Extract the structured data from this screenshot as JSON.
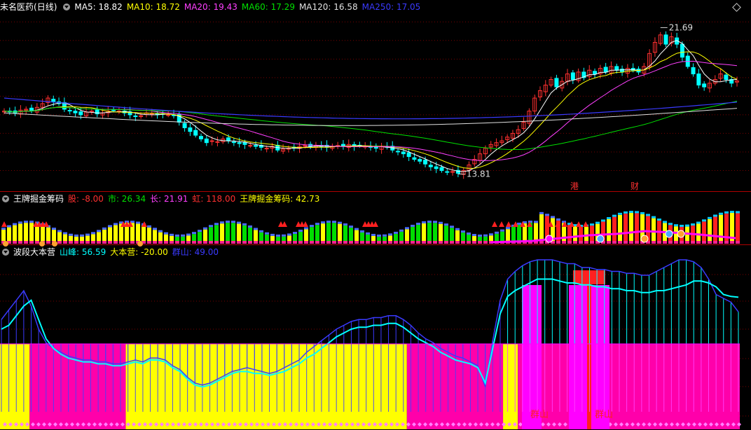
{
  "stock": {
    "name": "未名医药",
    "period": "(日线)"
  },
  "ma_header": [
    {
      "label": "MA5: 18.82",
      "color": "#ffffff"
    },
    {
      "label": "MA10: 18.72",
      "color": "#ffff00"
    },
    {
      "label": "MA20: 19.43",
      "color": "#ff40ff"
    },
    {
      "label": "MA60: 17.29",
      "color": "#00e000"
    },
    {
      "label": "MA120: 16.58",
      "color": "#e0e0e0"
    },
    {
      "label": "MA250: 17.05",
      "color": "#3a3aff"
    }
  ],
  "ind1": {
    "name": "王牌掘金筹码",
    "values": [
      {
        "label": "股: -8.00",
        "color": "#ff3030"
      },
      {
        "label": "市: 26.34",
        "color": "#00e000"
      },
      {
        "label": "长: 21.91",
        "color": "#ff40ff"
      },
      {
        "label": "虹: 118.00",
        "color": "#ff3030"
      },
      {
        "label": "王牌掘金筹码: 42.73",
        "color": "#ffff00"
      }
    ]
  },
  "ind2": {
    "name": "波段大本营",
    "values": [
      {
        "label": "山峰: 56.59",
        "color": "#00ffff"
      },
      {
        "label": "大本营: -20.00",
        "color": "#ffff00"
      },
      {
        "label": "群山: 49.00",
        "color": "#3a3aff"
      }
    ]
  },
  "price_labels": {
    "high": "21.69",
    "low": "13.81"
  },
  "event_marks": [
    "港",
    "财"
  ],
  "bottom_labels": [
    "群山",
    "群山"
  ],
  "colors": {
    "up": "#ff3030",
    "down": "#00ffff",
    "grid": "#7a0000",
    "sep": "#b00000"
  },
  "chart_data": {
    "type": "candlestick",
    "title": "未名医药(日线)",
    "ylim": [
      13.0,
      22.5
    ],
    "high_label": 21.69,
    "low_label": 13.81,
    "closes": [
      17.2,
      17.15,
      17.1,
      17.25,
      17.3,
      17.2,
      17.4,
      17.6,
      17.9,
      17.7,
      17.6,
      17.3,
      17.2,
      17.1,
      17.0,
      17.15,
      17.2,
      17.05,
      17.1,
      17.2,
      17.25,
      17.2,
      17.1,
      17.0,
      16.9,
      16.95,
      17.1,
      17.05,
      17.0,
      17.05,
      17.0,
      16.95,
      16.6,
      16.3,
      16.1,
      15.9,
      15.7,
      15.5,
      15.6,
      15.55,
      15.7,
      15.6,
      15.5,
      15.45,
      15.4,
      15.35,
      15.3,
      15.25,
      15.2,
      15.3,
      15.1,
      15.15,
      15.2,
      15.25,
      15.3,
      15.35,
      15.3,
      15.35,
      15.3,
      15.25,
      15.3,
      15.35,
      15.3,
      15.4,
      15.3,
      15.35,
      15.3,
      15.25,
      15.2,
      15.3,
      15.25,
      15.1,
      15.0,
      14.9,
      14.75,
      14.6,
      14.5,
      14.35,
      14.2,
      14.1,
      14.0,
      13.9,
      13.95,
      13.85,
      14.0,
      14.3,
      14.6,
      14.9,
      15.2,
      15.4,
      15.5,
      15.6,
      15.8,
      16.0,
      16.2,
      16.6,
      17.2,
      17.9,
      18.3,
      18.6,
      18.9,
      18.5,
      18.8,
      19.2,
      18.9,
      19.3,
      19.0,
      19.4,
      19.2,
      19.5,
      19.3,
      19.6,
      19.4,
      19.3,
      19.5,
      19.4,
      19.3,
      19.6,
      20.3,
      20.9,
      21.3,
      20.8,
      21.2,
      20.8,
      20.1,
      19.6,
      19.2,
      18.6,
      18.5,
      18.7,
      18.9,
      19.2,
      18.9,
      18.7,
      18.82
    ],
    "ma_series": [
      {
        "name": "MA5",
        "value": 18.82
      },
      {
        "name": "MA10",
        "value": 18.72
      },
      {
        "name": "MA20",
        "value": 19.43
      },
      {
        "name": "MA60",
        "value": 17.29
      },
      {
        "name": "MA120",
        "value": 16.58
      },
      {
        "name": "MA250",
        "value": 17.05
      }
    ],
    "wave_shanfeng": [
      40,
      42,
      47,
      52,
      55,
      45,
      35,
      30,
      27,
      25,
      24,
      23,
      23,
      22,
      22,
      21,
      21,
      22,
      23,
      22,
      24,
      24,
      23,
      20,
      18,
      14,
      11,
      10,
      11,
      13,
      15,
      17,
      18,
      18,
      17,
      17,
      16,
      17,
      18,
      20,
      22,
      25,
      27,
      30,
      33,
      36,
      38,
      40,
      41,
      41,
      42,
      42,
      43,
      43,
      41,
      38,
      35,
      33,
      31,
      28,
      26,
      24,
      23,
      22,
      20,
      12,
      30,
      48,
      57,
      60,
      62,
      64,
      66,
      66,
      66,
      65,
      64,
      64,
      63,
      63,
      62,
      62,
      61,
      61,
      60,
      60,
      59,
      59,
      60,
      60,
      61,
      62,
      63,
      65,
      65,
      64,
      62,
      58,
      57,
      56.59
    ],
    "wave_qunshan": [
      45,
      50,
      55,
      60,
      52,
      40,
      33,
      30,
      28,
      26,
      25,
      24,
      24,
      23,
      23,
      22,
      22,
      23,
      24,
      23,
      25,
      25,
      24,
      21,
      19,
      15,
      12,
      11,
      12,
      14,
      16,
      18,
      19,
      20,
      19,
      18,
      17,
      18,
      20,
      22,
      24,
      28,
      31,
      34,
      37,
      40,
      42,
      44,
      45,
      45,
      46,
      46,
      47,
      47,
      45,
      42,
      38,
      35,
      33,
      30,
      28,
      26,
      25,
      23,
      21,
      10,
      34,
      55,
      66,
      70,
      73,
      75,
      76,
      76,
      76,
      75,
      74,
      74,
      72,
      72,
      71,
      71,
      70,
      70,
      69,
      69,
      68,
      68,
      70,
      72,
      74,
      76,
      76,
      75,
      72,
      66,
      58,
      56,
      54,
      49
    ],
    "zones": [
      {
        "color": "yellow",
        "to": "4%"
      },
      {
        "color": "pink",
        "to": "17%"
      },
      {
        "color": "yellow",
        "to": "55%"
      },
      {
        "color": "pink",
        "to": "68%"
      },
      {
        "color": "yellow",
        "to": "70%"
      },
      {
        "color": "pink",
        "to": "100%"
      }
    ]
  }
}
